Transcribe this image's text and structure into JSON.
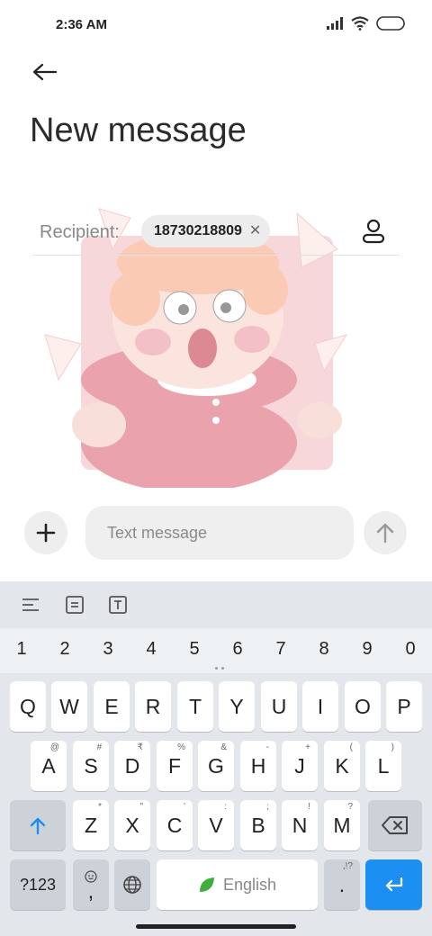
{
  "status": {
    "time": "2:36 AM"
  },
  "header": {
    "title": "New message"
  },
  "recipient": {
    "label": "Recipient:",
    "chip": "18730218809"
  },
  "compose": {
    "placeholder": "Text message"
  },
  "keyboard": {
    "numbers": [
      "1",
      "2",
      "3",
      "4",
      "5",
      "6",
      "7",
      "8",
      "9",
      "0"
    ],
    "row1": [
      "Q",
      "W",
      "E",
      "R",
      "T",
      "Y",
      "U",
      "I",
      "O",
      "P"
    ],
    "row2": [
      {
        "key": "A",
        "hint": "@"
      },
      {
        "key": "S",
        "hint": "#"
      },
      {
        "key": "D",
        "hint": "₹"
      },
      {
        "key": "F",
        "hint": "%"
      },
      {
        "key": "G",
        "hint": "&"
      },
      {
        "key": "H",
        "hint": "-"
      },
      {
        "key": "J",
        "hint": "+"
      },
      {
        "key": "K",
        "hint": "("
      },
      {
        "key": "L",
        "hint": ")"
      }
    ],
    "row3": [
      {
        "key": "Z",
        "hint": "*"
      },
      {
        "key": "X",
        "hint": "\""
      },
      {
        "key": "C",
        "hint": "'"
      },
      {
        "key": "V",
        "hint": ":"
      },
      {
        "key": "B",
        "hint": ";"
      },
      {
        "key": "N",
        "hint": "!"
      },
      {
        "key": "M",
        "hint": "?"
      }
    ],
    "symbols_label": "?123",
    "comma": ",",
    "space_label": "English",
    "period": ".",
    "period_hint": ",!?"
  },
  "colors": {
    "accent": "#1b8ff2",
    "keyboard_bg": "#e3e6ea"
  }
}
